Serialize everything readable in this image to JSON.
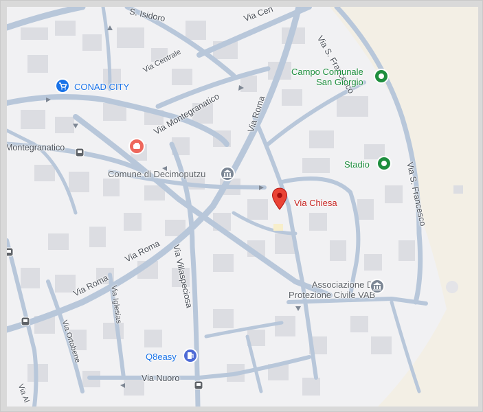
{
  "map": {
    "pin_label": "Via Chiesa",
    "pois": {
      "campo_line1": "Campo Comunale",
      "campo_line2": "San Giorgio",
      "stadio": "Stadio",
      "conad": "CONAD CITY",
      "comune": "Comune di Decimoputzu",
      "associazione_line1": "Associazione Di",
      "associazione_line2": "Protezione Civile VAB",
      "q8": "Q8easy"
    },
    "streets": {
      "s_isidoro": "S. Isidoro",
      "via_centrale_top": "Via Cen",
      "via_centrale": "Via Centrale",
      "via_san_francesco_top": "Via S. Francesco",
      "via_roma_n": "Via Roma",
      "via_montegranatico": "Via Montegranatico",
      "montegranatico_left": "Montegranatico",
      "via_s_francesco_right": "Via S. Francesco",
      "via_roma_w1": "Via Roma",
      "via_roma_w2": "Via Roma",
      "via_villaspeciosa": "Via Villaspeciosa",
      "via_iglesias": "Via Iglesias",
      "via_ortobene": "Via Ortobene",
      "via_nuoro": "Via Nuoro",
      "via_al": "Via Al"
    },
    "colors": {
      "land": "#f1f1f3",
      "road": "#b8c7da",
      "building": "#dcdde2",
      "beige": "#f3efe5",
      "pin": "#ea4335"
    },
    "icons": [
      "shopping-cart-icon",
      "government-building-icon",
      "restaurant-icon",
      "park-pin-icon",
      "gas-station-icon",
      "bus-stop-icon",
      "location-pin-icon"
    ]
  }
}
